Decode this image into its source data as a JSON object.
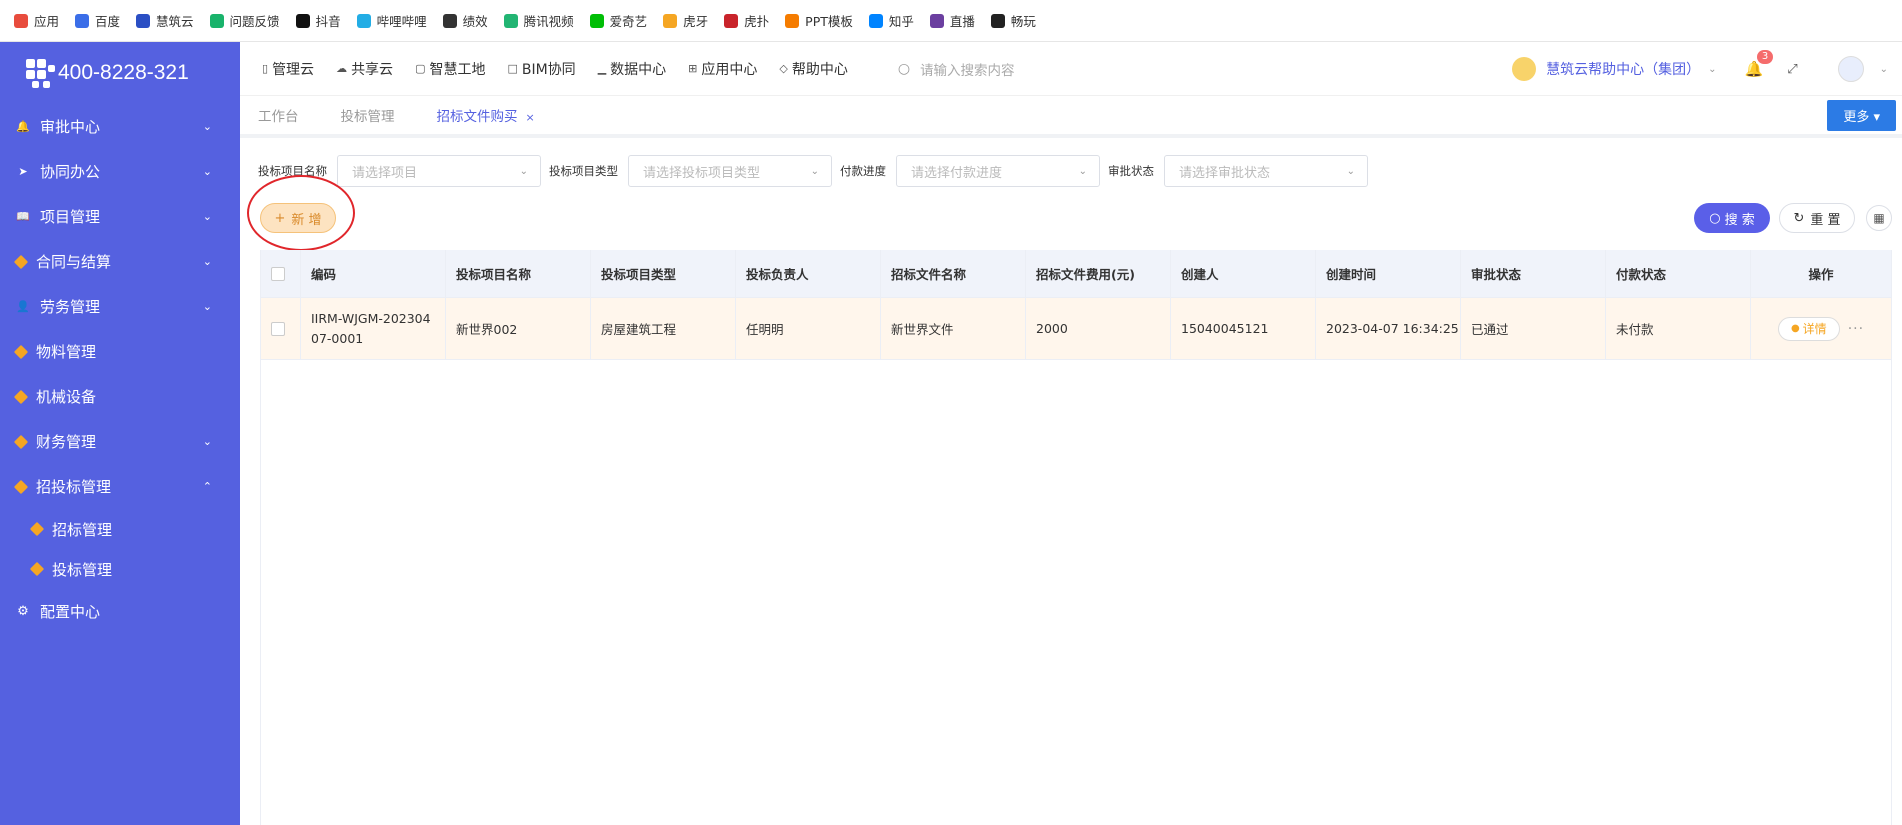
{
  "bookmarks": [
    {
      "label": "应用",
      "icon": "apps-grid-icon",
      "color": "#e84c3d"
    },
    {
      "label": "百度",
      "icon": "baidu-paw-icon",
      "color": "#3b6ee8"
    },
    {
      "label": "慧筑云",
      "icon": "huizhuyun-icon",
      "color": "#2b4fc4"
    },
    {
      "label": "问题反馈",
      "icon": "feedback-icon",
      "color": "#19b36b"
    },
    {
      "label": "抖音",
      "icon": "douyin-icon",
      "color": "#111111"
    },
    {
      "label": "哔哩哔哩",
      "icon": "bilibili-icon",
      "color": "#23ade5"
    },
    {
      "label": "绩效",
      "icon": "performance-icon",
      "color": "#333333"
    },
    {
      "label": "腾讯视频",
      "icon": "tencent-video-icon",
      "color": "#22b573"
    },
    {
      "label": "爱奇艺",
      "icon": "iqiyi-icon",
      "color": "#00be06"
    },
    {
      "label": "虎牙",
      "icon": "huya-icon",
      "color": "#f5a623"
    },
    {
      "label": "虎扑",
      "icon": "hupu-icon",
      "color": "#c9242b"
    },
    {
      "label": "PPT模板",
      "icon": "ppt-template-icon",
      "color": "#f57c00"
    },
    {
      "label": "知乎",
      "icon": "zhihu-icon",
      "color": "#0084ff"
    },
    {
      "label": "直播",
      "icon": "live-icon",
      "color": "#6b3fa0"
    },
    {
      "label": "畅玩",
      "icon": "game-icon",
      "color": "#222222"
    }
  ],
  "sidebar": {
    "phone": "400-8228-321",
    "items": [
      {
        "label": "审批中心",
        "icon": "bell-icon",
        "chevron": "down"
      },
      {
        "label": "协同办公",
        "icon": "send-icon",
        "chevron": "down"
      },
      {
        "label": "项目管理",
        "icon": "book-icon",
        "chevron": "down"
      },
      {
        "label": "合同与结算",
        "icon": "gem-icon",
        "chevron": "down"
      },
      {
        "label": "劳务管理",
        "icon": "worker-icon",
        "chevron": "down"
      },
      {
        "label": "物料管理",
        "icon": "gem-icon",
        "chevron": ""
      },
      {
        "label": "机械设备",
        "icon": "gem-icon",
        "chevron": ""
      },
      {
        "label": "财务管理",
        "icon": "gem-icon",
        "chevron": "down"
      },
      {
        "label": "招投标管理",
        "icon": "gem-icon",
        "chevron": "up"
      }
    ],
    "sub_items": [
      {
        "label": "招标管理"
      },
      {
        "label": "投标管理"
      }
    ],
    "config": {
      "label": "配置中心",
      "icon": "gear-icon"
    }
  },
  "topnav": {
    "items": [
      {
        "label": "管理云",
        "icon": "tablet-icon"
      },
      {
        "label": "共享云",
        "icon": "cloud-icon"
      },
      {
        "label": "智慧工地",
        "icon": "site-icon"
      },
      {
        "label": "BIM协同",
        "icon": "bim-icon"
      },
      {
        "label": "数据中心",
        "icon": "chart-icon"
      },
      {
        "label": "应用中心",
        "icon": "apps-icon"
      },
      {
        "label": "帮助中心",
        "icon": "help-diamond-icon"
      }
    ],
    "search_placeholder": "请输入搜索内容",
    "help_link": "慧筑云帮助中心（集团）",
    "notification_count": "3"
  },
  "tabs": {
    "items": [
      {
        "label": "工作台",
        "active": false
      },
      {
        "label": "投标管理",
        "active": false
      },
      {
        "label": "招标文件购买",
        "active": true
      }
    ],
    "more_label": "更多"
  },
  "filters": [
    {
      "label": "投标项目名称",
      "placeholder": "请选择项目"
    },
    {
      "label": "投标项目类型",
      "placeholder": "请选择投标项目类型"
    },
    {
      "label": "付款进度",
      "placeholder": "请选择付款进度"
    },
    {
      "label": "审批状态",
      "placeholder": "请选择审批状态"
    }
  ],
  "actions": {
    "add_label": "新 增",
    "search_label": "搜 索",
    "reset_label": "重 置"
  },
  "table": {
    "columns": [
      "编码",
      "投标项目名称",
      "投标项目类型",
      "投标负责人",
      "招标文件名称",
      "招标文件费用(元)",
      "创建人",
      "创建时间",
      "审批状态",
      "付款状态",
      "操作"
    ],
    "rows": [
      {
        "code": "IIRM-WJGM-20230407-0001",
        "project_name": "新世界002",
        "project_type": "房屋建筑工程",
        "owner": "任明明",
        "doc_name": "新世界文件",
        "fee": "2000",
        "creator": "15040045121",
        "created_at": "2023-04-07 16:34:25",
        "approval_status": "已通过",
        "payment_status": "未付款",
        "action_label": "详情"
      }
    ]
  }
}
